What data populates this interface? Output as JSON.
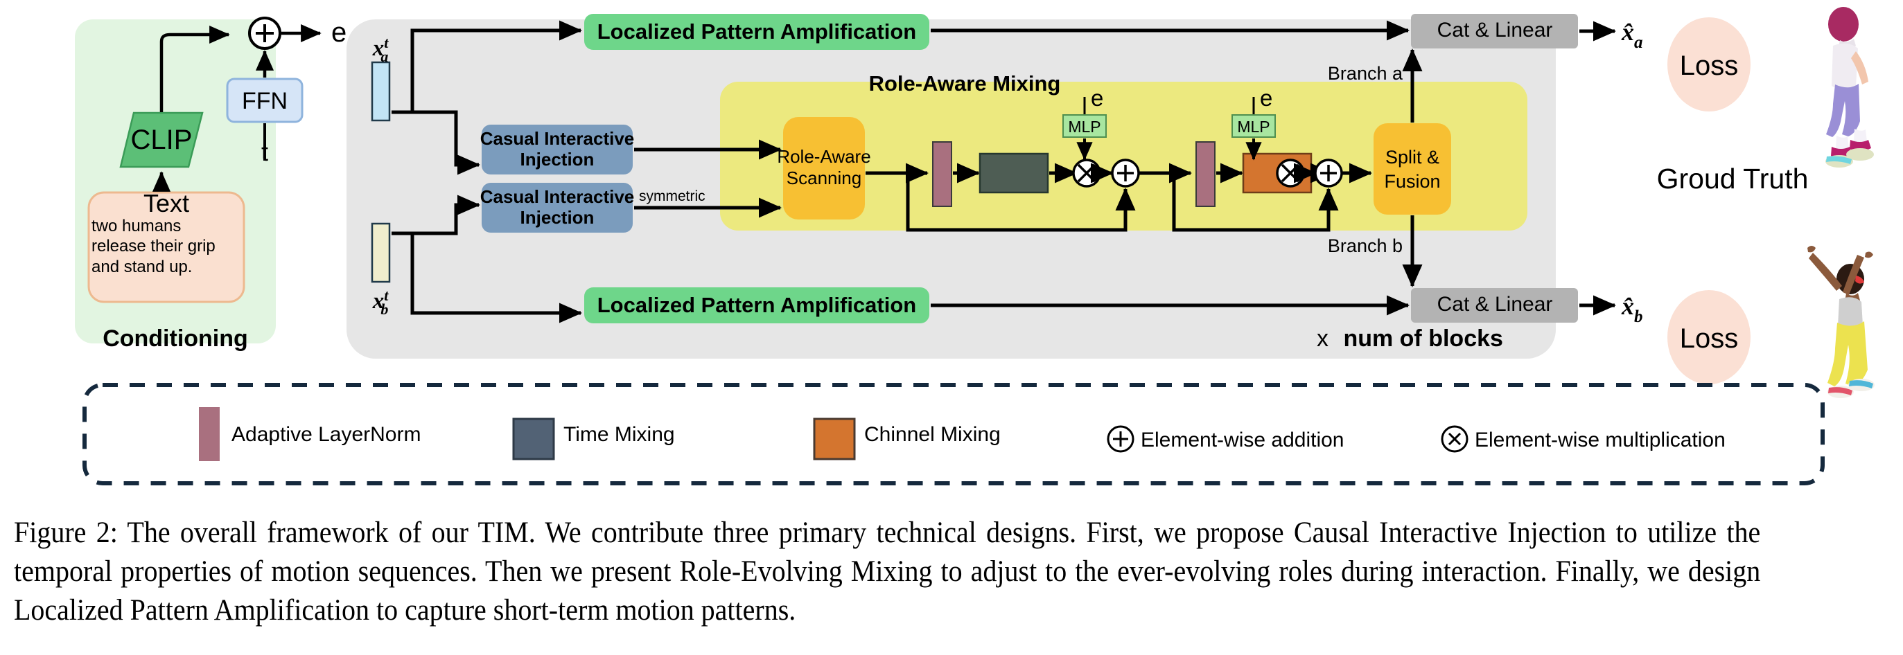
{
  "figure": {
    "caption": "Figure 2: The overall framework of our TIM. We contribute three primary technical designs. First, we propose Causal Interactive Injection to utilize the temporal properties of motion sequences. Then we present Role-Evolving Mixing to adjust to the ever-evolving roles during interaction. Finally, we design Localized Pattern Amplification to capture short-term motion patterns."
  },
  "conditioning": {
    "panel_label": "Conditioning",
    "clip_label": "CLIP",
    "ffn_label": "FFN",
    "timestep_label": "t",
    "embedding_label": "e",
    "text_box": {
      "title": "Text",
      "prompt": "two humans release their grip and stand up."
    },
    "colors": {
      "panel_bg": "#e2f5e1",
      "clip_fill": "#5cbf77",
      "ffn_fill": "#d6e5f7",
      "text_fill": "#fae0d0"
    }
  },
  "main_block": {
    "repeat_label_prefix": "x",
    "repeat_label": "num of blocks",
    "inputs": [
      {
        "name": "x_a",
        "base": "x",
        "sup": "t",
        "sub": "a",
        "color": "#c2e4f5"
      },
      {
        "name": "x_b",
        "base": "x",
        "sup": "t",
        "sub": "b",
        "color": "#f0eecd"
      }
    ],
    "lpa_top_label": "Localized Pattern Amplification",
    "lpa_bottom_label": "Localized Pattern Amplification",
    "cii_top_label_line1": "Casual Interactive",
    "cii_top_label_line2": "Injection",
    "cii_bottom_label_line1": "Casual Interactive",
    "cii_bottom_label_line2": "Injection",
    "symmetric_label": "symmetric",
    "cat_linear_top": "Cat & Linear",
    "cat_linear_bottom": "Cat & Linear",
    "colors": {
      "block_bg": "#e6e6e6",
      "lpa_fill": "#6ed68a",
      "cii_fill": "#7b9cbd",
      "cat_fill": "#b3b3b3"
    }
  },
  "role_aware_mixing": {
    "title": "Role-Aware Mixing",
    "scanning_label_line1": "Role-Aware",
    "scanning_label_line2": "Scanning",
    "split_fusion_line1": "Split &",
    "split_fusion_line2": "Fusion",
    "branch_a_label": "Branch a",
    "branch_b_label": "Branch b",
    "mlp_label": "MLP",
    "embedding_label": "e",
    "mul_symbol": "⊗",
    "add_symbol": "⊕",
    "colors": {
      "region_fill": "#ece97f",
      "scanning_fill": "#f7c033",
      "fusion_fill": "#f7c033",
      "mlp_fill": "#a8e6a0",
      "layernorm_fill": "#a9707f",
      "time_mixing_fill": "#4e5d54",
      "channel_mixing_fill": "#d4752f"
    }
  },
  "outputs": {
    "top": {
      "base": "x",
      "sub": "a",
      "loss_label": "Loss"
    },
    "bottom": {
      "base": "x",
      "sub": "b",
      "loss_label": "Loss"
    },
    "ground_truth_label": "Groud Truth",
    "loss_fill": "#fbe0d4"
  },
  "legend": {
    "items": [
      {
        "key": "adaptive-layernorm",
        "label": "Adaptive LayerNorm",
        "glyph": "bar",
        "color": "#a9707f"
      },
      {
        "key": "time-mixing",
        "label": "Time Mixing",
        "glyph": "square",
        "color": "#526275"
      },
      {
        "key": "channel-mixing",
        "label": "Chinnel Mixing",
        "glyph": "square",
        "color": "#d4752f"
      },
      {
        "key": "element-wise-addition",
        "label": "Element-wise addition",
        "glyph": "circle-plus",
        "color": "#000000"
      },
      {
        "key": "element-wise-multiplication",
        "label": "Element-wise multiplication",
        "glyph": "circle-times",
        "color": "#000000"
      }
    ],
    "border_color": "#15293d"
  }
}
